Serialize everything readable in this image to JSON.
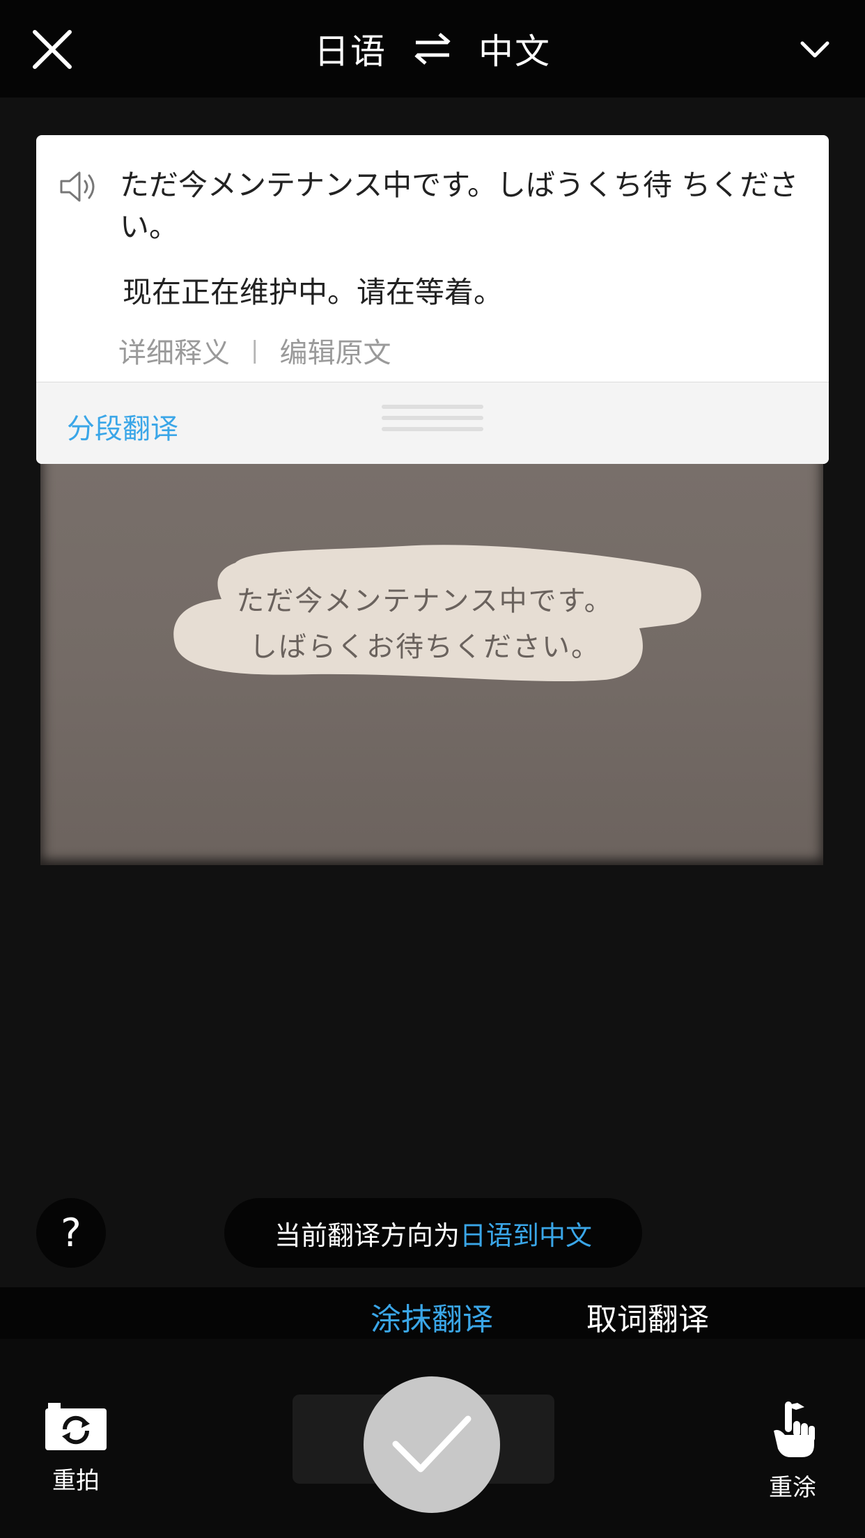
{
  "header": {
    "source_lang": "日语",
    "target_lang": "中文",
    "swap_icon": "swap-arrows-icon",
    "close_icon": "close-icon",
    "menu_icon": "chevron-down-icon"
  },
  "card": {
    "source_text": "ただ今メンテナンス中です。しばうくち待 ちください。",
    "translation": "现在正在维护中。请在等着。",
    "detail_link": "详细释义",
    "separator": "|",
    "edit_link": "编辑原文",
    "segment_button": "分段翻译"
  },
  "photo": {
    "recognized_text_line1": "ただ今メンテナンス中です。",
    "recognized_text_line2": "しばらくお待ちください。"
  },
  "direction": {
    "prefix": "当前翻译方向为",
    "from": "日语",
    "connector": "到",
    "to": "中文"
  },
  "help": {
    "label": "?"
  },
  "modes": {
    "smear": "涂抹翻译",
    "word": "取词翻译",
    "active": "smear"
  },
  "actions": {
    "retake": "重拍",
    "repaint": "重涂"
  },
  "colors": {
    "accent": "#3aa6e8",
    "background": "#0d0d0d"
  }
}
